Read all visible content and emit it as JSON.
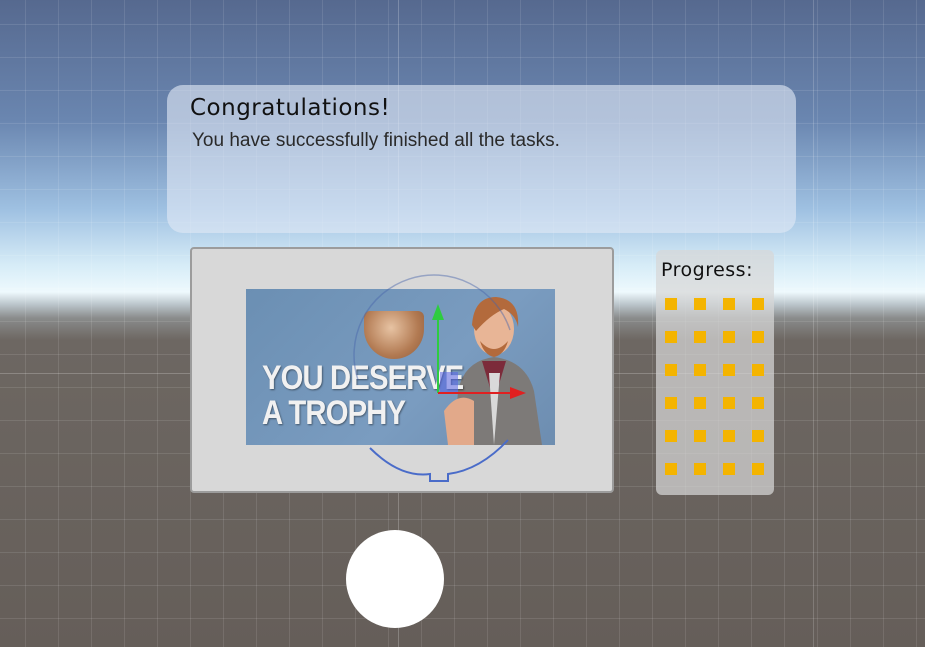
{
  "scene": {
    "background": "Unity scene view with skybox and grid"
  },
  "congrats_panel": {
    "title": "Congratulations!",
    "message": "You have successfully finished all the tasks."
  },
  "image_panel": {
    "image_caption_line1": "YOU DESERVE",
    "image_caption_line2": "A TROPHY"
  },
  "progress_panel": {
    "label": "Progress:",
    "completed_count": 24,
    "dot_color": "#f4b400"
  },
  "colors": {
    "panel_gray": "#d8d8d8",
    "gizmo_x": "#e02020",
    "gizmo_y": "#2ecc40",
    "gizmo_z": "#4a6cc9"
  },
  "continue_button": {
    "shape": "circle"
  }
}
